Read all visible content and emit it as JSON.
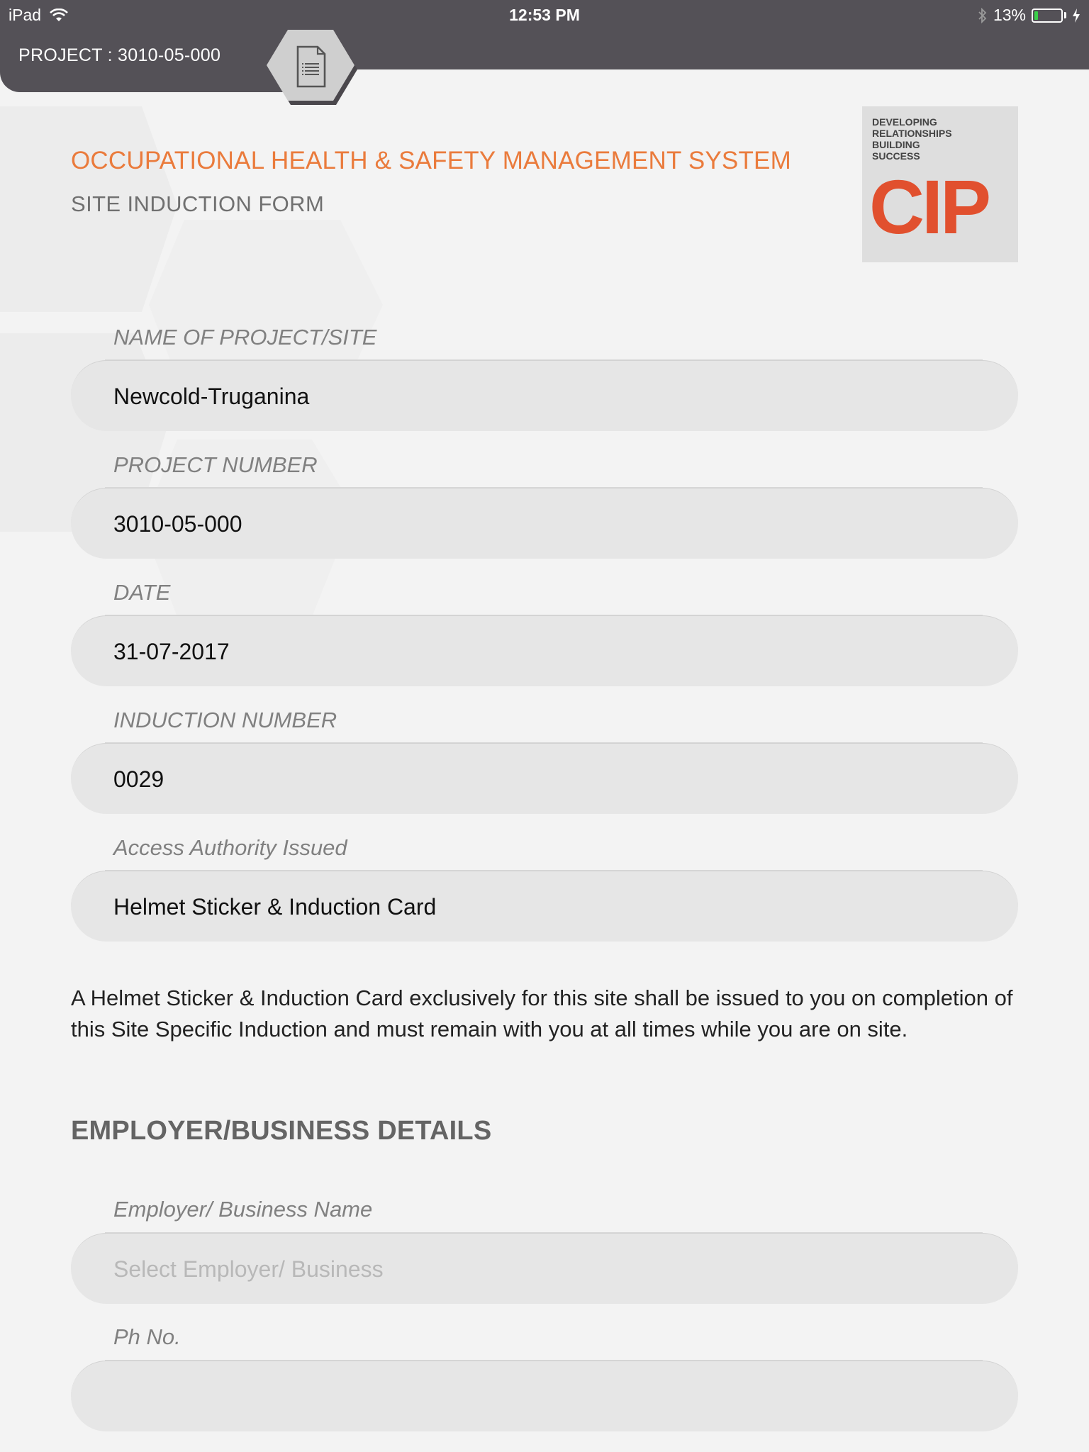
{
  "status_bar": {
    "device": "iPad",
    "time": "12:53 PM",
    "battery_percent": "13%",
    "battery_level": 0.13,
    "wifi_icon": "wifi-icon",
    "bluetooth_icon": "bluetooth-icon",
    "charging_icon": "charging-bolt-icon"
  },
  "header": {
    "project_label": "PROJECT : 3010-05-000",
    "document_icon": "document-icon"
  },
  "form": {
    "title": "OCCUPATIONAL HEALTH & SAFETY MANAGEMENT SYSTEM",
    "subtitle": "SITE  INDUCTION FORM",
    "logo": {
      "tagline": [
        "DEVELOPING",
        "RELATIONSHIPS",
        "BUILDING",
        "SUCCESS"
      ],
      "wordmark": "CIP"
    },
    "fields": [
      {
        "label": "NAME OF PROJECT/SITE",
        "value": "Newcold-Truganina"
      },
      {
        "label": "PROJECT NUMBER",
        "value": "3010-05-000"
      },
      {
        "label": "DATE",
        "value": "31-07-2017"
      },
      {
        "label": "INDUCTION NUMBER",
        "value": "0029"
      },
      {
        "label": "Access Authority Issued",
        "value": "Helmet Sticker & Induction Card"
      }
    ],
    "notice": "A Helmet Sticker & Induction Card exclusively for this site shall be issued to you on completion of this Site Specific Induction and must remain with you at all times while you are on site.",
    "employer_section": {
      "heading": "EMPLOYER/BUSINESS DETAILS",
      "fields": [
        {
          "label": "Employer/ Business Name",
          "value": "",
          "placeholder": "Select Employer/ Business"
        },
        {
          "label": "Ph No.",
          "value": "",
          "placeholder": ""
        }
      ]
    }
  },
  "colors": {
    "header_bg": "#545157",
    "accent_orange": "#ea7b3c",
    "logo_red": "#e1502e",
    "field_bg": "#e6e6e6",
    "page_bg": "#f3f3f3"
  }
}
